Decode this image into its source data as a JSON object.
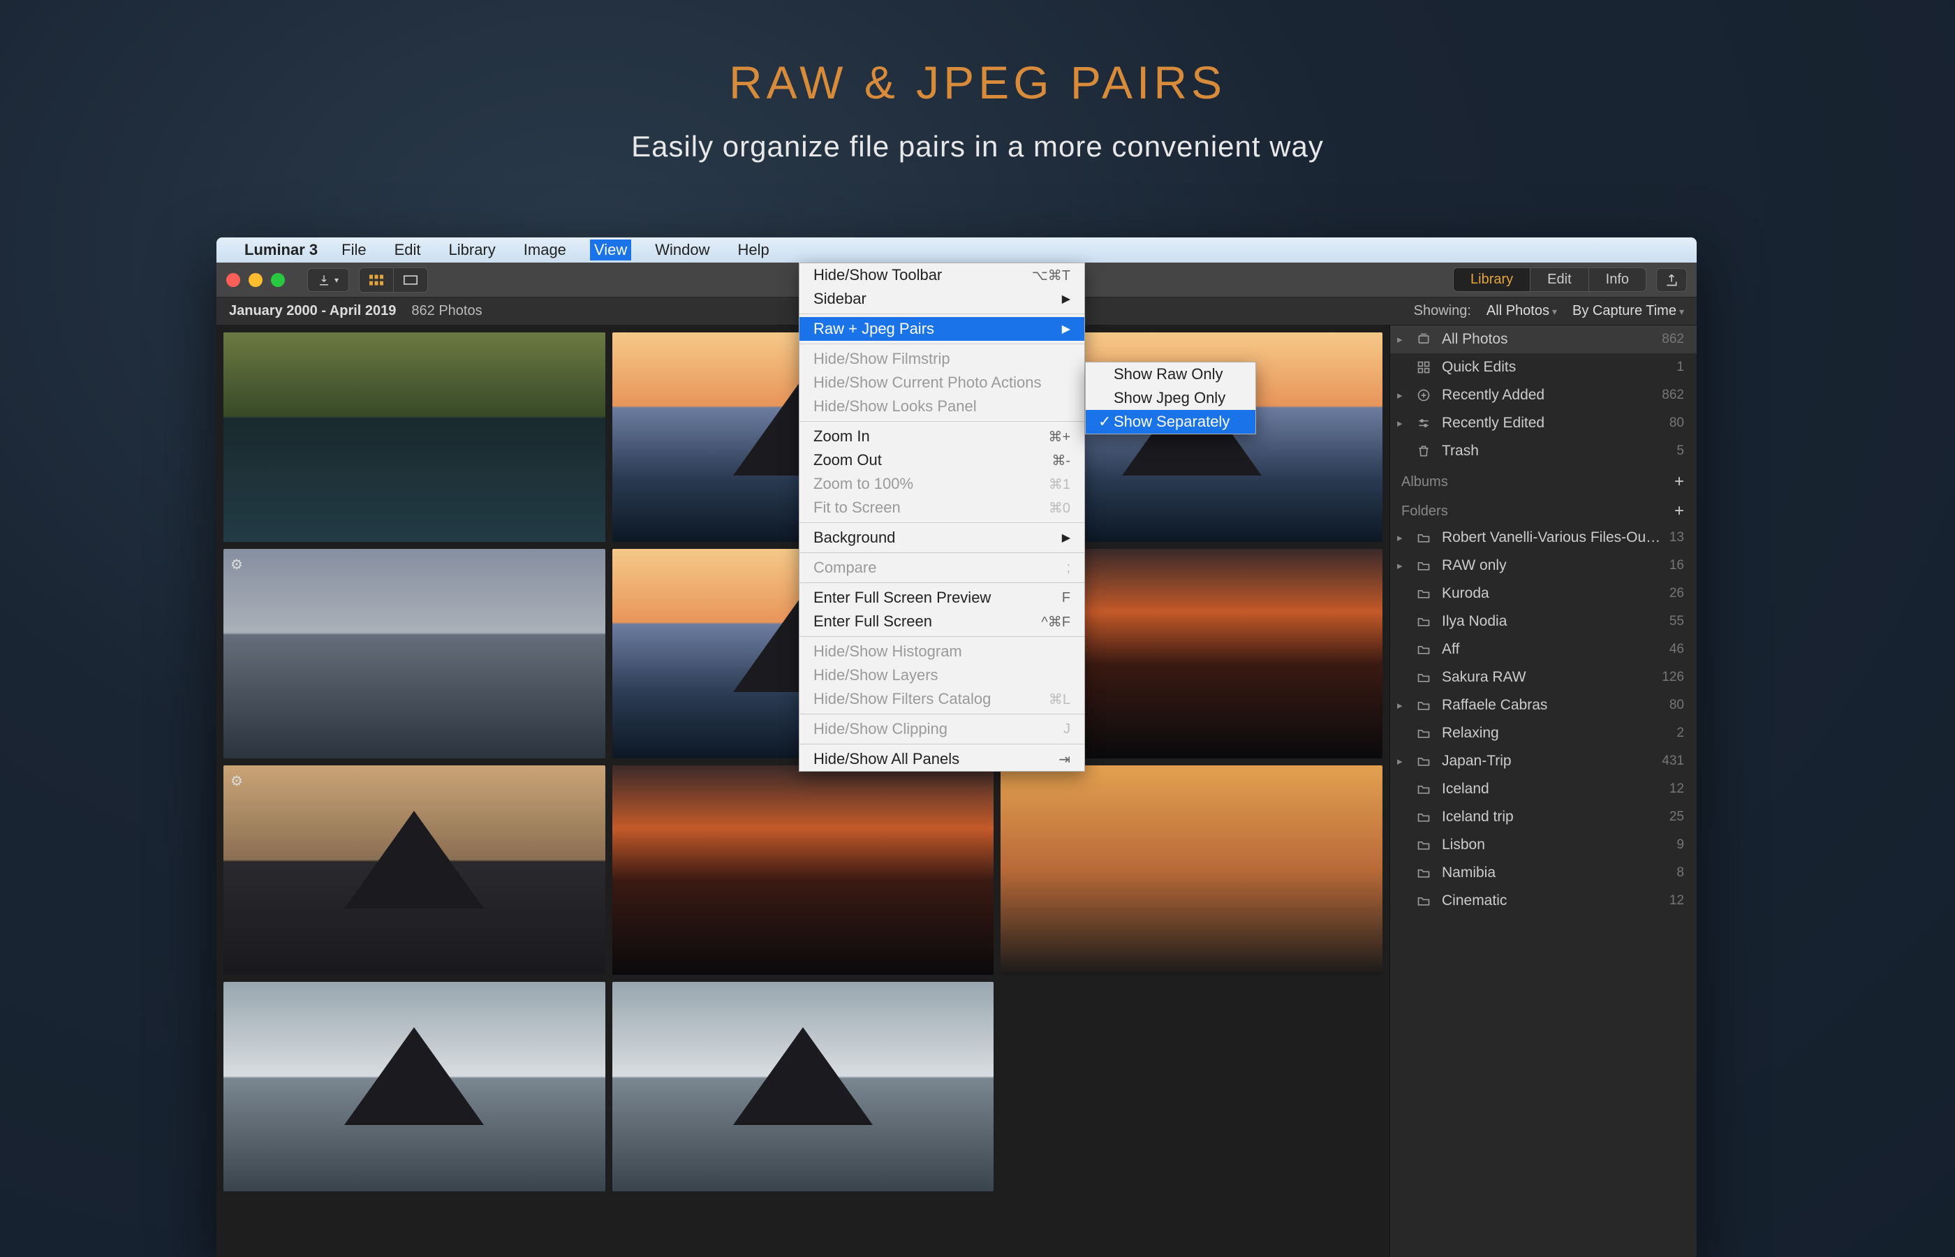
{
  "hero": {
    "title": "RAW & JPEG PAIRS",
    "subtitle": "Easily organize file pairs in a more convenient way"
  },
  "menubar": {
    "app": "Luminar 3",
    "items": [
      "File",
      "Edit",
      "Library",
      "Image",
      "View",
      "Window",
      "Help"
    ],
    "active": "View"
  },
  "toolbar": {
    "segments": {
      "library": "Library",
      "edit": "Edit",
      "info": "Info"
    }
  },
  "subheader": {
    "title_truncated": "All Photos",
    "date_range": "January 2000 - April 2019",
    "count": "862 Photos",
    "showing_label": "Showing:",
    "showing_value": "All Photos",
    "sort_value": "By Capture Time"
  },
  "view_menu": [
    {
      "label": "Hide/Show Toolbar",
      "shortcut": "⌥⌘T"
    },
    {
      "label": "Sidebar",
      "submenu": true
    },
    {
      "sep": true
    },
    {
      "label": "Raw + Jpeg Pairs",
      "submenu": true,
      "highlight": true
    },
    {
      "sep": true
    },
    {
      "label": "Hide/Show Filmstrip",
      "disabled": true
    },
    {
      "label": "Hide/Show Current Photo Actions",
      "disabled": true
    },
    {
      "label": "Hide/Show Looks Panel",
      "disabled": true
    },
    {
      "sep": true
    },
    {
      "label": "Zoom In",
      "shortcut": "⌘+"
    },
    {
      "label": "Zoom Out",
      "shortcut": "⌘-"
    },
    {
      "label": "Zoom to 100%",
      "shortcut": "⌘1",
      "disabled": true
    },
    {
      "label": "Fit to Screen",
      "shortcut": "⌘0",
      "disabled": true
    },
    {
      "sep": true
    },
    {
      "label": "Background",
      "submenu": true
    },
    {
      "sep": true
    },
    {
      "label": "Compare",
      "shortcut": ";",
      "disabled": true
    },
    {
      "sep": true
    },
    {
      "label": "Enter Full Screen Preview",
      "shortcut": "F"
    },
    {
      "label": "Enter Full Screen",
      "shortcut": "^⌘F"
    },
    {
      "sep": true
    },
    {
      "label": "Hide/Show Histogram",
      "disabled": true
    },
    {
      "label": "Hide/Show Layers",
      "disabled": true
    },
    {
      "label": "Hide/Show Filters Catalog",
      "shortcut": "⌘L",
      "disabled": true
    },
    {
      "sep": true
    },
    {
      "label": "Hide/Show Clipping",
      "shortcut": "J",
      "disabled": true
    },
    {
      "sep": true
    },
    {
      "label": "Hide/Show All Panels",
      "shortcut": "⇥"
    }
  ],
  "raw_jpeg_submenu": [
    {
      "label": "Show Raw Only"
    },
    {
      "label": "Show Jpeg Only"
    },
    {
      "label": "Show Separately",
      "checked": true,
      "highlight": true
    }
  ],
  "sidebar": {
    "shortcuts": [
      {
        "icon": "stack",
        "label": "All Photos",
        "count": "862",
        "disclose": true,
        "active": true
      },
      {
        "icon": "grid",
        "label": "Quick Edits",
        "count": "1"
      },
      {
        "icon": "plus-circle",
        "label": "Recently Added",
        "count": "862",
        "disclose": true
      },
      {
        "icon": "sliders",
        "label": "Recently Edited",
        "count": "80",
        "disclose": true
      },
      {
        "icon": "trash",
        "label": "Trash",
        "count": "5"
      }
    ],
    "albums_header": "Albums",
    "folders_header": "Folders",
    "folders": [
      {
        "label": "Robert Vanelli-Various Files-Out…",
        "count": "13",
        "disclose": true
      },
      {
        "label": "RAW only",
        "count": "16",
        "disclose": true
      },
      {
        "label": "Kuroda",
        "count": "26"
      },
      {
        "label": "Ilya Nodia",
        "count": "55"
      },
      {
        "label": "Aff",
        "count": "46"
      },
      {
        "label": "Sakura RAW",
        "count": "126"
      },
      {
        "label": "Raffaele Cabras",
        "count": "80",
        "disclose": true
      },
      {
        "label": "Relaxing",
        "count": "2"
      },
      {
        "label": "Japan-Trip",
        "count": "431",
        "disclose": true
      },
      {
        "label": "Iceland",
        "count": "12"
      },
      {
        "label": "Iceland trip",
        "count": "25"
      },
      {
        "label": "Lisbon",
        "count": "9"
      },
      {
        "label": "Namibia",
        "count": "8"
      },
      {
        "label": "Cinematic",
        "count": "12"
      }
    ]
  },
  "thumbs": [
    {
      "cls": "land-a",
      "sel": true
    },
    {
      "cls": "land-b",
      "mountain": true,
      "fav": true
    },
    {
      "cls": "land-b",
      "mountain": true
    },
    {
      "cls": "land-d",
      "adj": true
    },
    {
      "cls": "land-b",
      "mountain": true
    },
    {
      "cls": "land-e"
    },
    {
      "cls": "land-c",
      "mountain": true,
      "adj": true
    },
    {
      "cls": "land-e"
    },
    {
      "cls": "land-f"
    },
    {
      "cls": "land-g",
      "mountain": true
    },
    {
      "cls": "land-g",
      "mountain": true
    }
  ]
}
